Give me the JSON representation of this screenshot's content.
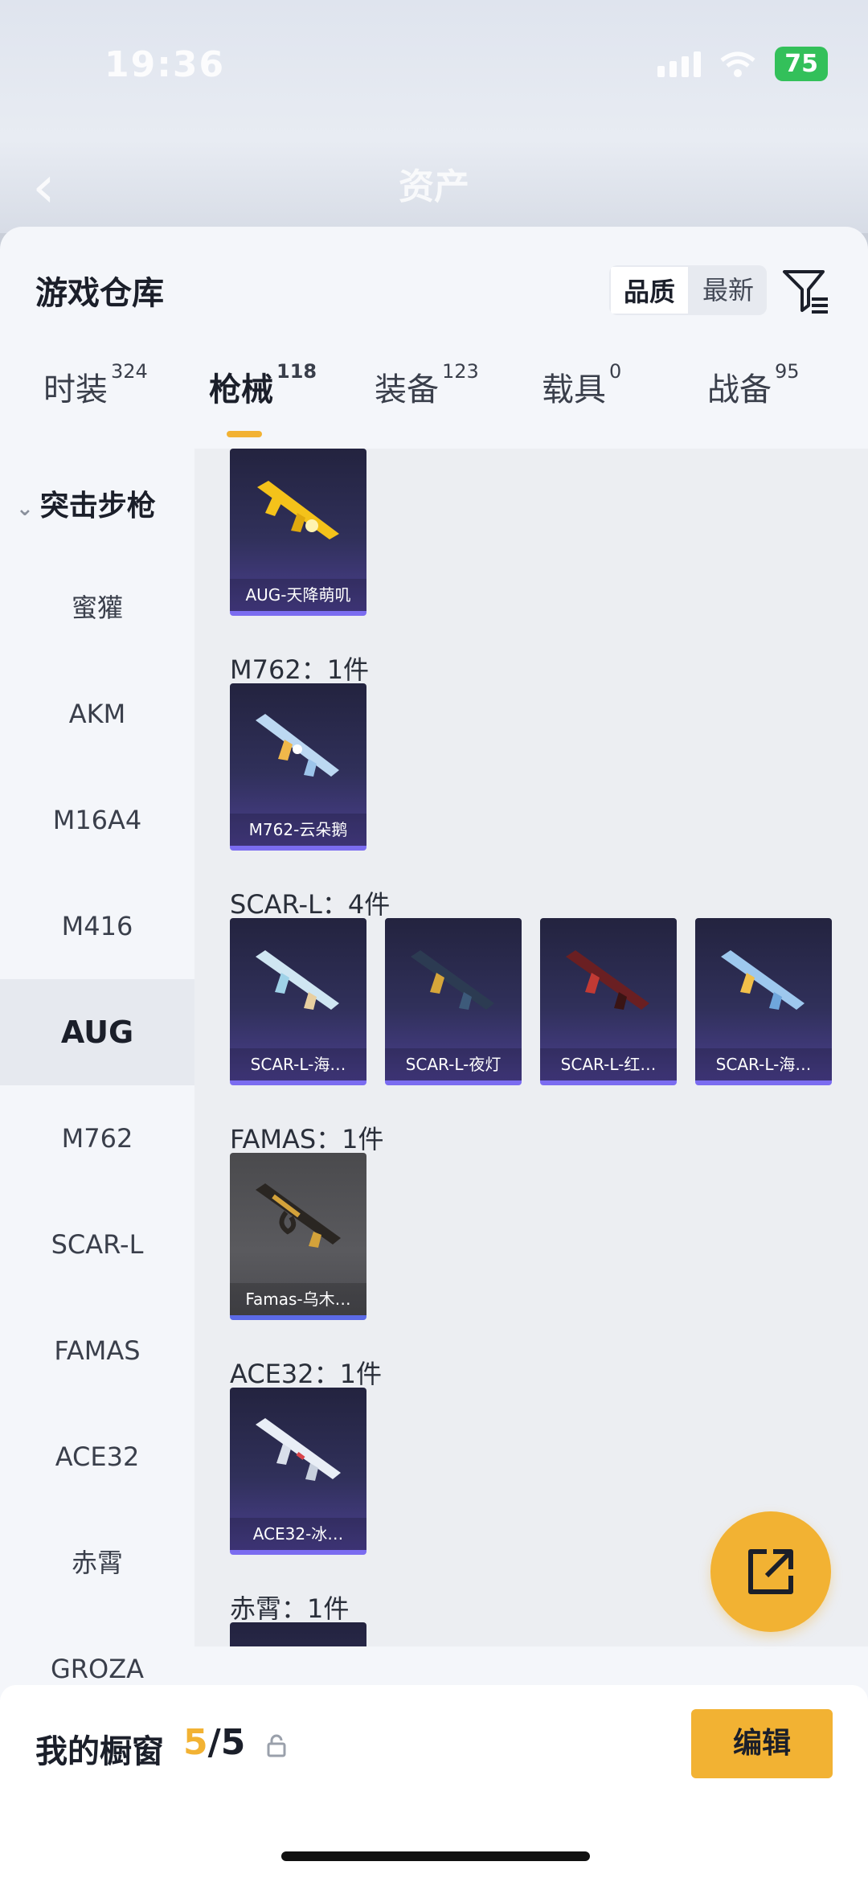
{
  "status_bar": {
    "time": "19:36",
    "battery": "75"
  },
  "nav": {
    "title": "资产",
    "back_icon": "chevron-left-icon"
  },
  "sheet": {
    "title": "游戏仓库",
    "sort_options": [
      "品质",
      "最新"
    ],
    "filter_icon": "filter-icon"
  },
  "tabs": [
    {
      "label": "时装",
      "count": "324"
    },
    {
      "label": "枪械",
      "count": "118"
    },
    {
      "label": "装备",
      "count": "123"
    },
    {
      "label": "载具",
      "count": "0"
    },
    {
      "label": "战备",
      "count": "95"
    }
  ],
  "sidebar": {
    "group": "突击步枪",
    "items": [
      "蜜獾",
      "AKM",
      "M16A4",
      "M416",
      "AUG",
      "M762",
      "SCAR-L",
      "FAMAS",
      "ACE32",
      "赤霄",
      "GROZA"
    ]
  },
  "content": {
    "groups": [
      {
        "label": "",
        "cards": [
          "AUG-天降萌叽"
        ]
      },
      {
        "label": "M762：1件",
        "cards": [
          "M762-云朵鹅"
        ]
      },
      {
        "label": "SCAR-L：4件",
        "cards": [
          "SCAR-L-海…",
          "SCAR-L-夜灯",
          "SCAR-L-红…",
          "SCAR-L-海…"
        ]
      },
      {
        "label": "FAMAS：1件",
        "cards": [
          "Famas-乌木…"
        ]
      },
      {
        "label": "ACE32：1件",
        "cards": [
          "ACE32-冰…"
        ]
      },
      {
        "label": "赤霄：1件",
        "cards": [
          ""
        ]
      }
    ]
  },
  "fab": {
    "icon": "share-external-icon"
  },
  "bottom_bar": {
    "title": "我的橱窗",
    "count_current": "5",
    "count_total": "/5",
    "lock_icon": "lock-icon",
    "edit_label": "编辑"
  },
  "colors": {
    "accent": "#f2b233",
    "card_purple": "#30305a"
  }
}
